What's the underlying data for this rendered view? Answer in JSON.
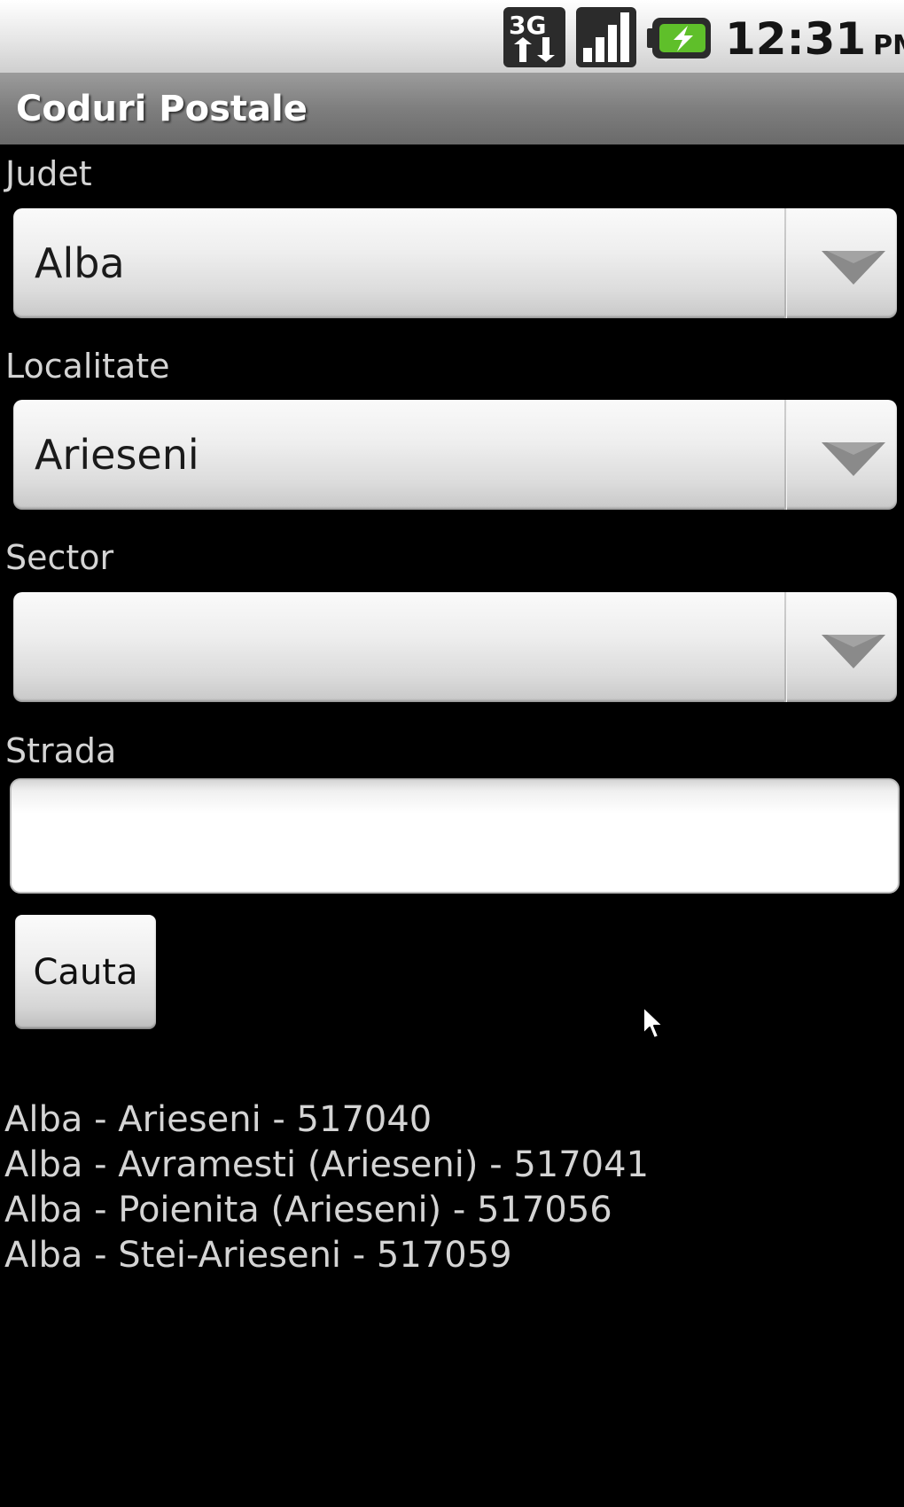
{
  "status_bar": {
    "network": "3G",
    "time": "12:31",
    "ampm": "PM",
    "icons": [
      "data-3g-icon",
      "signal-strength-icon",
      "battery-charging-icon"
    ]
  },
  "app": {
    "title": "Coduri Postale"
  },
  "form": {
    "county_label": "Judet",
    "county_value": "Alba",
    "locality_label": "Localitate",
    "locality_value": "Arieseni",
    "sector_label": "Sector",
    "sector_value": "",
    "street_label": "Strada",
    "street_value": "",
    "search_label": "Cauta"
  },
  "results": [
    "Alba - Arieseni - 517040",
    "Alba - Avramesti (Arieseni) - 517041",
    "Alba - Poienita (Arieseni) - 517056",
    "Alba - Stei-Arieseni - 517059"
  ],
  "colors": {
    "background": "#000000",
    "label_text": "#d4d4d4",
    "title_text": "#ffffff",
    "battery_green": "#5fbf2a"
  }
}
